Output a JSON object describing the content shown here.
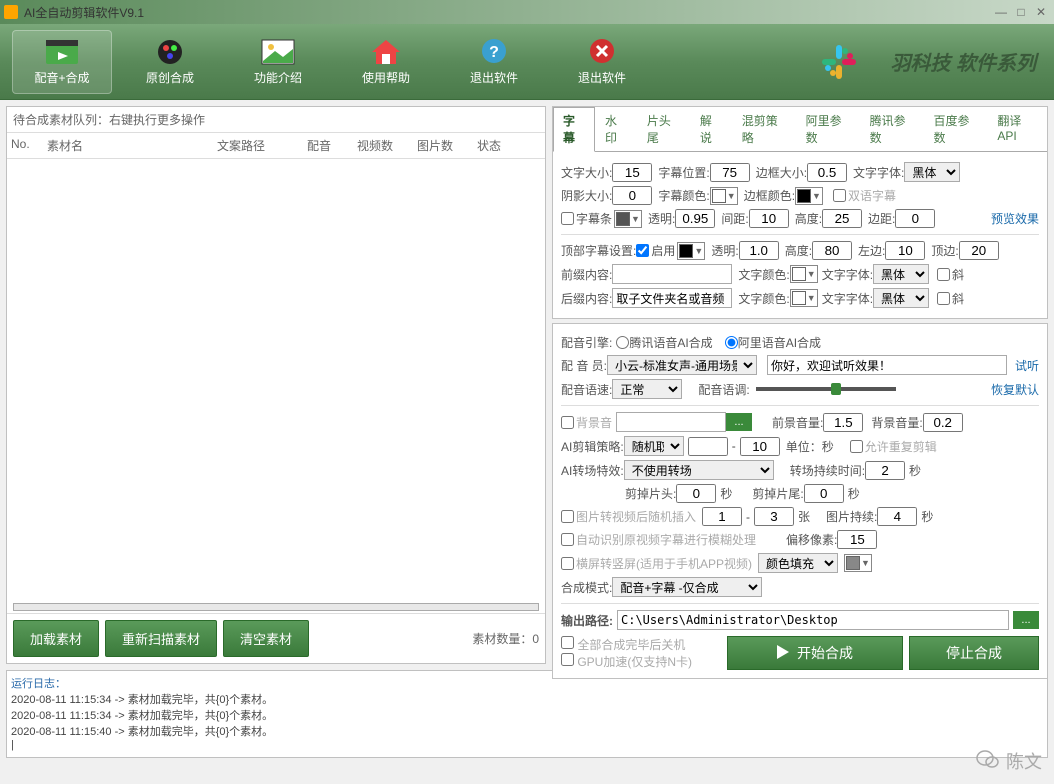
{
  "window": {
    "title": "AI全自动剪辑软件V9.1"
  },
  "toolbar": {
    "items": [
      {
        "label": "配音+合成"
      },
      {
        "label": "原创合成"
      },
      {
        "label": "功能介绍"
      },
      {
        "label": "使用帮助"
      },
      {
        "label": "退出软件"
      }
    ],
    "brand": "羽科技 软件系列"
  },
  "left": {
    "header": "待合成素材队列：右键执行更多操作",
    "cols": {
      "no": "No.",
      "name": "素材名",
      "path": "文案路径",
      "audio": "配音",
      "vcount": "视频数",
      "icount": "图片数",
      "status": "状态"
    },
    "btn_load": "加载素材",
    "btn_rescan": "重新扫描素材",
    "btn_clear": "清空素材",
    "count_label": "素材数量：0"
  },
  "tabs": [
    "字幕",
    "水印",
    "片头尾",
    "解说",
    "混剪策略",
    "阿里参数",
    "腾讯参数",
    "百度参数",
    "翻译API"
  ],
  "sub": {
    "font_size_lbl": "文字大小:",
    "font_size": "15",
    "pos_lbl": "字幕位置:",
    "pos": "75",
    "border_lbl": "边框大小:",
    "border": "0.5",
    "font_lbl": "文字字体:",
    "font": "黑体",
    "shadow_lbl": "阴影大小:",
    "shadow": "0",
    "color_lbl": "字幕颜色:",
    "border_color_lbl": "边框颜色:",
    "bilingual": "双语字幕",
    "bar_lbl": "字幕条",
    "opacity_lbl": "透明:",
    "opacity": "0.95",
    "gap_lbl": "间距:",
    "gap": "10",
    "height_lbl": "高度:",
    "height": "25",
    "margin_lbl": "边距:",
    "margin": "0",
    "preview": "预览效果",
    "top_lbl": "顶部字幕设置:",
    "enable": "启用",
    "top_opacity": "1.0",
    "top_height": "80",
    "top_left_lbl": "左边:",
    "top_left": "10",
    "top_tmargin_lbl": "顶边:",
    "top_tmargin": "20",
    "prefix_lbl": "前缀内容:",
    "prefix": "",
    "text_color_lbl": "文字颜色:",
    "text_font_lbl": "文字字体:",
    "italic": "斜",
    "suffix_lbl": "后缀内容:",
    "suffix": "取子文件夹名或音频"
  },
  "voice": {
    "engine_lbl": "配音引擎:",
    "opt1": "腾讯语音AI合成",
    "opt2": "阿里语音AI合成",
    "actor_lbl": "配 音 员:",
    "actor": "小云-标准女声-通用场景",
    "greet": "你好，欢迎试听效果！",
    "test": "试听",
    "speed_lbl": "配音语速:",
    "speed": "正常",
    "tone_lbl": "配音语调:",
    "reset": "恢复默认",
    "bg_lbl": "背景音",
    "fg_vol_lbl": "前景音量:",
    "fg_vol": "1.5",
    "bg_vol_lbl": "背景音量:",
    "bg_vol": "0.2",
    "strategy_lbl": "AI剪辑策略:",
    "strategy": "随机取",
    "rng_to": "10",
    "unit_lbl": "单位：秒",
    "allow_dup": "允许重复剪辑",
    "transition_lbl": "AI转场特效:",
    "transition": "不使用转场",
    "trans_dur_lbl": "转场持续时间:",
    "trans_dur": "2",
    "sec": "秒",
    "cut_head_lbl": "剪掉片头:",
    "cut_head": "0",
    "cut_tail_lbl": "剪掉片尾:",
    "cut_tail": "0",
    "img_insert_lbl": "图片转视频后随机插入",
    "img_from": "1",
    "img_to": "3",
    "img_unit": "张",
    "img_dur_lbl": "图片持续:",
    "img_dur": "4",
    "auto_blur_lbl": "自动识别原视频字幕进行模糊处理",
    "offset_lbl": "偏移像素:",
    "offset": "15",
    "rotate_lbl": "横屏转竖屏(适用于手机APP视频)",
    "fill_mode": "颜色填充",
    "mode_lbl": "合成模式:",
    "mode": "配音+字幕 -仅合成",
    "out_lbl": "输出路径:",
    "out_path": "C:\\Users\\Administrator\\Desktop",
    "shutdown_lbl": "全部合成完毕后关机",
    "gpu_lbl": "GPU加速(仅支持N卡)",
    "start": "开始合成",
    "stop": "停止合成"
  },
  "log": {
    "header": "运行日志：",
    "l1": "2020-08-11 11:15:34 -> 素材加载完毕，共{0}个素材。",
    "l2": "2020-08-11 11:15:34 -> 素材加载完毕，共{0}个素材。",
    "l3": "2020-08-11 11:15:40 -> 素材加载完毕，共{0}个素材。"
  },
  "watermark": "陈文"
}
